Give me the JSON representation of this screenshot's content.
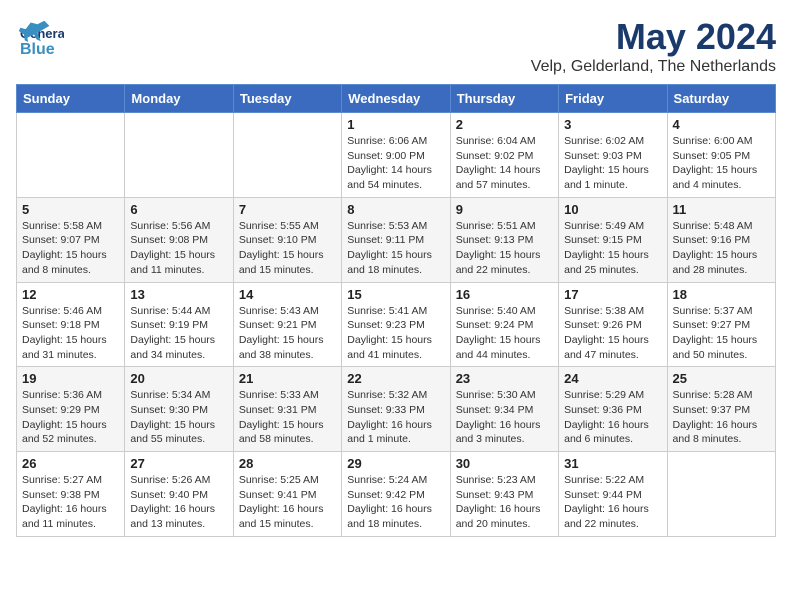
{
  "header": {
    "logo_general": "General",
    "logo_blue": "Blue",
    "month": "May 2024",
    "location": "Velp, Gelderland, The Netherlands"
  },
  "days_of_week": [
    "Sunday",
    "Monday",
    "Tuesday",
    "Wednesday",
    "Thursday",
    "Friday",
    "Saturday"
  ],
  "weeks": [
    [
      {
        "day": "",
        "info": ""
      },
      {
        "day": "",
        "info": ""
      },
      {
        "day": "",
        "info": ""
      },
      {
        "day": "1",
        "info": "Sunrise: 6:06 AM\nSunset: 9:00 PM\nDaylight: 14 hours\nand 54 minutes."
      },
      {
        "day": "2",
        "info": "Sunrise: 6:04 AM\nSunset: 9:02 PM\nDaylight: 14 hours\nand 57 minutes."
      },
      {
        "day": "3",
        "info": "Sunrise: 6:02 AM\nSunset: 9:03 PM\nDaylight: 15 hours\nand 1 minute."
      },
      {
        "day": "4",
        "info": "Sunrise: 6:00 AM\nSunset: 9:05 PM\nDaylight: 15 hours\nand 4 minutes."
      }
    ],
    [
      {
        "day": "5",
        "info": "Sunrise: 5:58 AM\nSunset: 9:07 PM\nDaylight: 15 hours\nand 8 minutes."
      },
      {
        "day": "6",
        "info": "Sunrise: 5:56 AM\nSunset: 9:08 PM\nDaylight: 15 hours\nand 11 minutes."
      },
      {
        "day": "7",
        "info": "Sunrise: 5:55 AM\nSunset: 9:10 PM\nDaylight: 15 hours\nand 15 minutes."
      },
      {
        "day": "8",
        "info": "Sunrise: 5:53 AM\nSunset: 9:11 PM\nDaylight: 15 hours\nand 18 minutes."
      },
      {
        "day": "9",
        "info": "Sunrise: 5:51 AM\nSunset: 9:13 PM\nDaylight: 15 hours\nand 22 minutes."
      },
      {
        "day": "10",
        "info": "Sunrise: 5:49 AM\nSunset: 9:15 PM\nDaylight: 15 hours\nand 25 minutes."
      },
      {
        "day": "11",
        "info": "Sunrise: 5:48 AM\nSunset: 9:16 PM\nDaylight: 15 hours\nand 28 minutes."
      }
    ],
    [
      {
        "day": "12",
        "info": "Sunrise: 5:46 AM\nSunset: 9:18 PM\nDaylight: 15 hours\nand 31 minutes."
      },
      {
        "day": "13",
        "info": "Sunrise: 5:44 AM\nSunset: 9:19 PM\nDaylight: 15 hours\nand 34 minutes."
      },
      {
        "day": "14",
        "info": "Sunrise: 5:43 AM\nSunset: 9:21 PM\nDaylight: 15 hours\nand 38 minutes."
      },
      {
        "day": "15",
        "info": "Sunrise: 5:41 AM\nSunset: 9:23 PM\nDaylight: 15 hours\nand 41 minutes."
      },
      {
        "day": "16",
        "info": "Sunrise: 5:40 AM\nSunset: 9:24 PM\nDaylight: 15 hours\nand 44 minutes."
      },
      {
        "day": "17",
        "info": "Sunrise: 5:38 AM\nSunset: 9:26 PM\nDaylight: 15 hours\nand 47 minutes."
      },
      {
        "day": "18",
        "info": "Sunrise: 5:37 AM\nSunset: 9:27 PM\nDaylight: 15 hours\nand 50 minutes."
      }
    ],
    [
      {
        "day": "19",
        "info": "Sunrise: 5:36 AM\nSunset: 9:29 PM\nDaylight: 15 hours\nand 52 minutes."
      },
      {
        "day": "20",
        "info": "Sunrise: 5:34 AM\nSunset: 9:30 PM\nDaylight: 15 hours\nand 55 minutes."
      },
      {
        "day": "21",
        "info": "Sunrise: 5:33 AM\nSunset: 9:31 PM\nDaylight: 15 hours\nand 58 minutes."
      },
      {
        "day": "22",
        "info": "Sunrise: 5:32 AM\nSunset: 9:33 PM\nDaylight: 16 hours\nand 1 minute."
      },
      {
        "day": "23",
        "info": "Sunrise: 5:30 AM\nSunset: 9:34 PM\nDaylight: 16 hours\nand 3 minutes."
      },
      {
        "day": "24",
        "info": "Sunrise: 5:29 AM\nSunset: 9:36 PM\nDaylight: 16 hours\nand 6 minutes."
      },
      {
        "day": "25",
        "info": "Sunrise: 5:28 AM\nSunset: 9:37 PM\nDaylight: 16 hours\nand 8 minutes."
      }
    ],
    [
      {
        "day": "26",
        "info": "Sunrise: 5:27 AM\nSunset: 9:38 PM\nDaylight: 16 hours\nand 11 minutes."
      },
      {
        "day": "27",
        "info": "Sunrise: 5:26 AM\nSunset: 9:40 PM\nDaylight: 16 hours\nand 13 minutes."
      },
      {
        "day": "28",
        "info": "Sunrise: 5:25 AM\nSunset: 9:41 PM\nDaylight: 16 hours\nand 15 minutes."
      },
      {
        "day": "29",
        "info": "Sunrise: 5:24 AM\nSunset: 9:42 PM\nDaylight: 16 hours\nand 18 minutes."
      },
      {
        "day": "30",
        "info": "Sunrise: 5:23 AM\nSunset: 9:43 PM\nDaylight: 16 hours\nand 20 minutes."
      },
      {
        "day": "31",
        "info": "Sunrise: 5:22 AM\nSunset: 9:44 PM\nDaylight: 16 hours\nand 22 minutes."
      },
      {
        "day": "",
        "info": ""
      }
    ]
  ]
}
